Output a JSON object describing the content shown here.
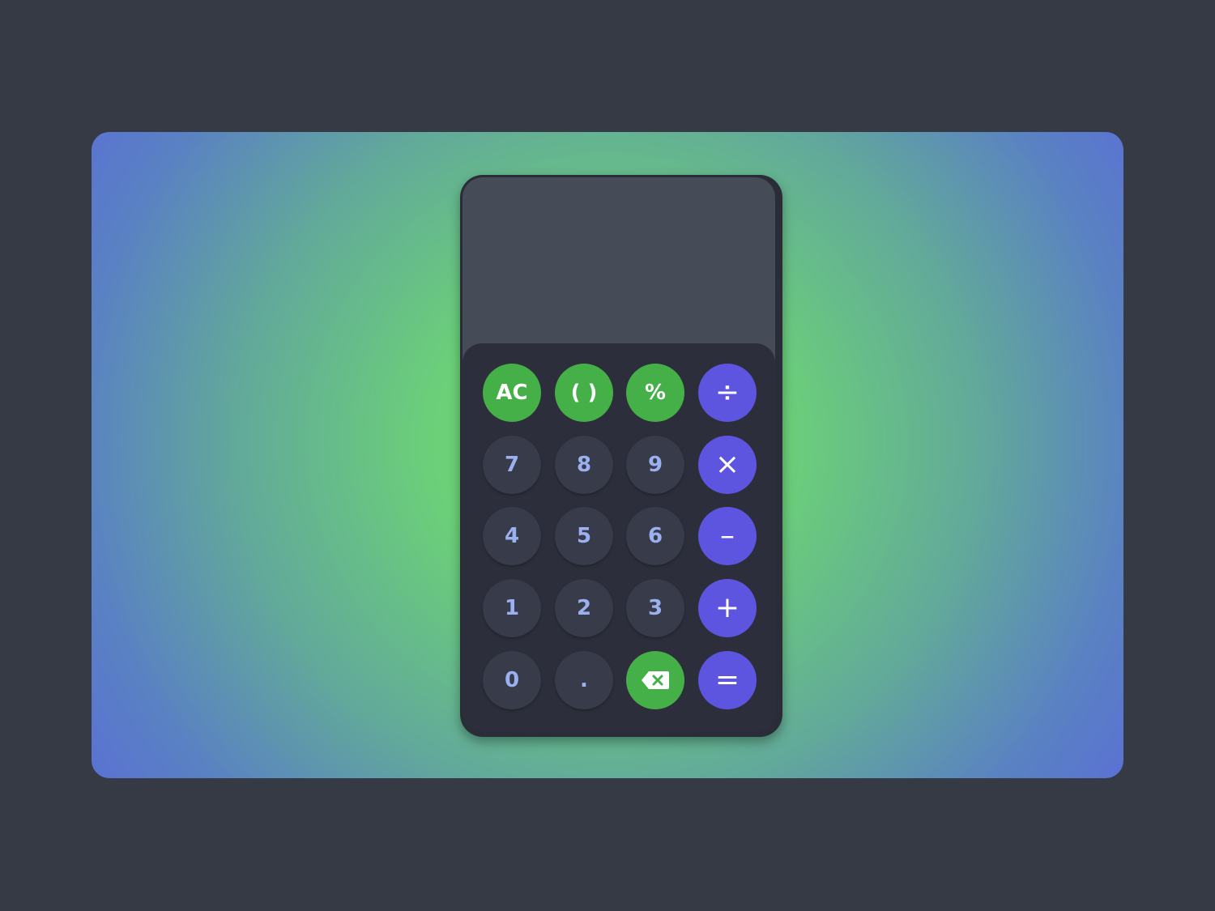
{
  "display": {
    "value": ""
  },
  "keys": {
    "clear": "AC",
    "parentheses": "( )",
    "percent": "%",
    "divide": "÷",
    "seven": "7",
    "eight": "8",
    "nine": "9",
    "multiply": "×",
    "four": "4",
    "five": "5",
    "six": "6",
    "subtract": "–",
    "one": "1",
    "two": "2",
    "three": "3",
    "add": "+",
    "zero": "0",
    "decimal": ".",
    "backspace_icon": "backspace-icon",
    "equals": "="
  },
  "colors": {
    "page_background": "#353a44",
    "calculator_body": "#2a2d38",
    "screen": "#454b57",
    "number_key": "#373b4a",
    "number_text": "#9bb0ef",
    "function_key": "#45b048",
    "operator_key": "#5d55e0"
  }
}
